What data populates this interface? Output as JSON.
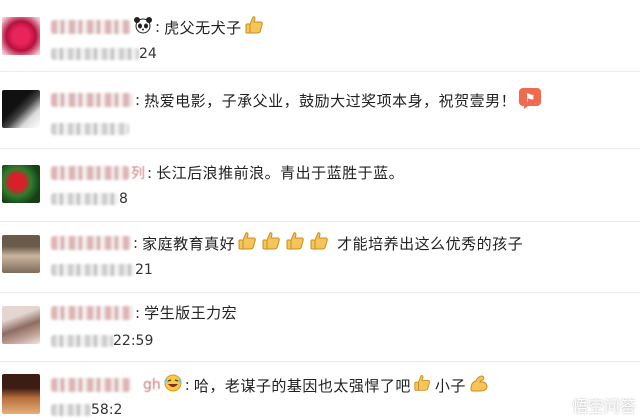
{
  "comments": [
    {
      "content": "虎父无犬子",
      "time_tail": "24",
      "prefix_emoji": "panda-icon",
      "suffix_emoji": [
        "thumbs-up-icon"
      ]
    },
    {
      "content": "热爱电影，子承父业，鼓励大过奖项本身，祝贺壹男！",
      "time_tail": "",
      "suffix_emoji": [
        "cheer-icon"
      ]
    },
    {
      "name_suffix": "列",
      "content": "长江后浪推前浪。青出于蓝胜于蓝。",
      "time_tail": "8"
    },
    {
      "content_part1": "家庭教育真好",
      "content_part2": "才能培养出这么优秀的孩子",
      "time_tail": "21",
      "suffix_emoji": [
        "thumbs-up-icon",
        "thumbs-up-icon",
        "thumbs-up-icon",
        "thumbs-up-icon"
      ]
    },
    {
      "content": "学生版王力宏",
      "time_tail": "22:59"
    },
    {
      "name_suffix": "gh",
      "content_part1": "哈，老谋子的基因也太强悍了吧",
      "content_part2": "小子",
      "time_tail": "58:2",
      "prefix_emoji": "laughing-face-icon",
      "suffix_emoji": [
        "thumbs-up-icon",
        "flexed-biceps-icon"
      ]
    }
  ],
  "watermark": {
    "text": "悟空问答",
    "logo": "wukong-logo-icon"
  },
  "colors": {
    "divider": "#ebebeb",
    "text": "#222222",
    "cheer_badge": "#f06a4f"
  }
}
